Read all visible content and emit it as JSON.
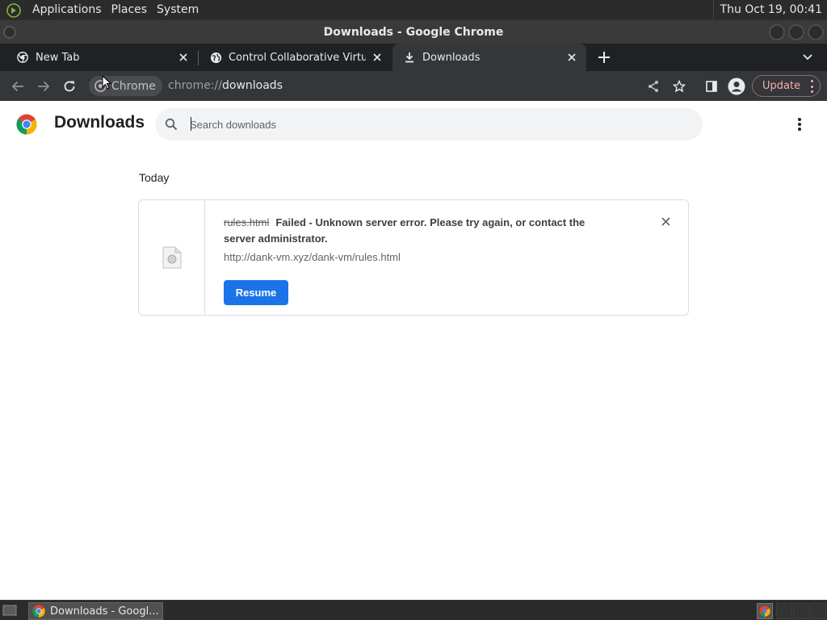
{
  "panel": {
    "menus": [
      "Applications",
      "Places",
      "System"
    ],
    "clock": "Thu Oct 19, 00:41"
  },
  "window": {
    "title": "Downloads - Google Chrome"
  },
  "tabs": [
    {
      "label": "New Tab",
      "icon": "chrome-icon",
      "active": false
    },
    {
      "label": "Control Collaborative Virtual M",
      "icon": "globe-icon",
      "active": false
    },
    {
      "label": "Downloads",
      "icon": "download-icon",
      "active": true
    }
  ],
  "toolbar": {
    "site_chip": "Chrome",
    "url_scheme": "chrome://",
    "url_host": "downloads",
    "update_label": "Update"
  },
  "downloads_page": {
    "title": "Downloads",
    "search_placeholder": "Search downloads",
    "section_date": "Today",
    "items": [
      {
        "file_name": "rules.html",
        "status": "Failed - Unknown server error. Please try again, or contact the server administrator.",
        "url": "http://dank-vm.xyz/dank-vm/rules.html",
        "action_label": "Resume"
      }
    ]
  },
  "taskbar": {
    "task_label": "Downloads - Googl..."
  },
  "colors": {
    "accent_blue": "#1a73e8",
    "update_pink": "#f6aea9",
    "tabstrip_bg": "#202124",
    "toolbar_bg": "#35363a"
  }
}
